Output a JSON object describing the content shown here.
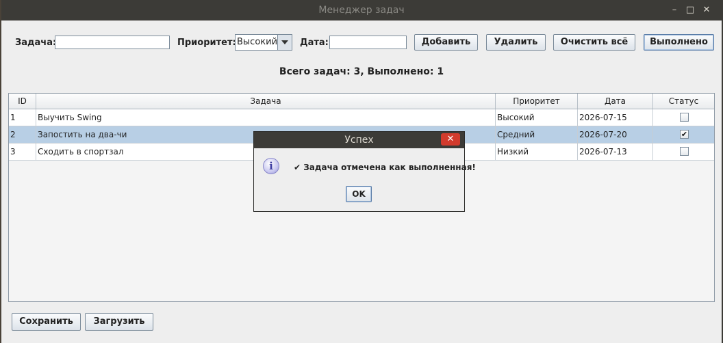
{
  "window": {
    "title": "Менеджер задач",
    "minimize": "–",
    "maximize": "□",
    "close": "✕"
  },
  "form": {
    "task_label": "Задача:",
    "task_value": "",
    "priority_label": "Приоритет:",
    "priority_selected": "Высокий",
    "date_label": "Дата:",
    "date_value": ""
  },
  "buttons": {
    "add": "Добавить",
    "delete": "Удалить",
    "clear_all": "Очистить всё",
    "done": "Выполнено"
  },
  "summary": "Всего задач: 3, Выполнено: 1",
  "table": {
    "columns": [
      "ID",
      "Задача",
      "Приоритет",
      "Дата",
      "Статус"
    ],
    "rows": [
      {
        "id": "1",
        "task": "Выучить Swing",
        "priority": "Высокий",
        "date": "2026-07-15",
        "done": false,
        "selected": false
      },
      {
        "id": "2",
        "task": "Запостить на два-чи",
        "priority": "Средний",
        "date": "2026-07-20",
        "done": true,
        "selected": true
      },
      {
        "id": "3",
        "task": "Сходить в спортзал",
        "priority": "Низкий",
        "date": "2026-07-13",
        "done": false,
        "selected": false
      }
    ]
  },
  "bottom_buttons": {
    "save": "Сохранить",
    "load": "Загрузить"
  },
  "dialog": {
    "title": "Успех",
    "icon": "info-icon",
    "message": "✔ Задача отмечена как выполненная!",
    "ok": "OK",
    "close": "✕"
  },
  "colors": {
    "titlebar": "#3c3b37",
    "selected_row": "#b8cfe5",
    "close_red": "#d23b2d"
  }
}
